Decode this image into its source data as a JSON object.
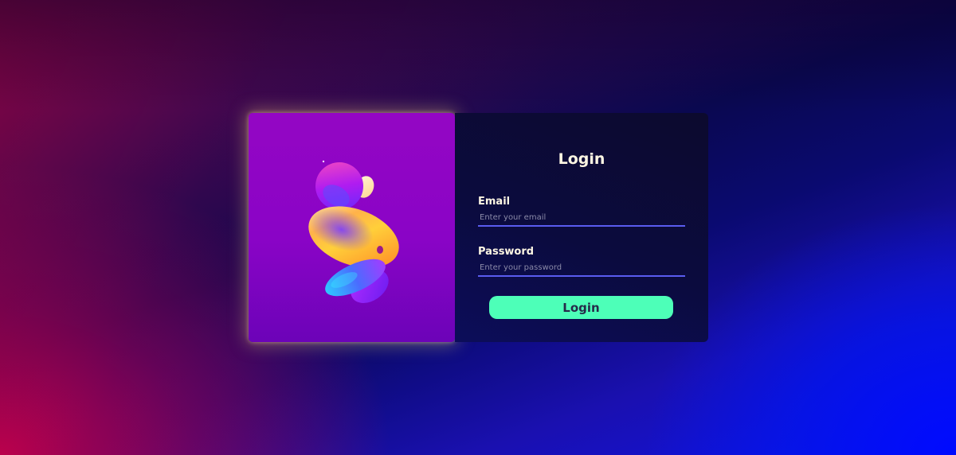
{
  "login_card": {
    "title": "Login",
    "email": {
      "label": "Email",
      "placeholder": "Enter your email",
      "value": ""
    },
    "password": {
      "label": "Password",
      "placeholder": "Enter your password",
      "value": ""
    },
    "submit_label": "Login"
  },
  "colors": {
    "art_panel": "#8a04c6",
    "form_panel": "#0b0b3e",
    "input_underline": "#5a5cf0",
    "button": "#4dffb8",
    "text": "#fdf6e3"
  },
  "illustration": {
    "icon": "abstract-3d-shapes"
  }
}
